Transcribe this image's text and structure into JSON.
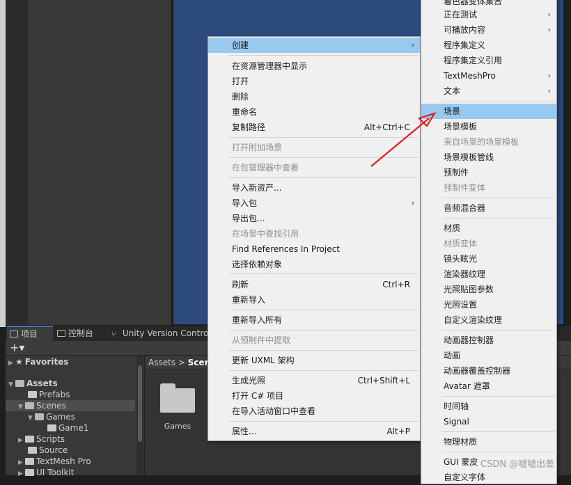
{
  "bottom_tabs": [
    {
      "label": "项目",
      "icon": "folder-icon"
    },
    {
      "label": "控制台",
      "icon": "console-icon"
    },
    {
      "label": "Unity Version Control",
      "icon": "branch-icon"
    }
  ],
  "toolbar": {
    "add_label": "+▾"
  },
  "tree": {
    "favorites": "Favorites",
    "assets": "Assets",
    "items": [
      "Prefabs",
      "Scenes",
      "Games",
      "Game1",
      "Scripts",
      "Source",
      "TextMesh Pro",
      "UI Toolkit"
    ]
  },
  "breadcrumb": {
    "root": "Assets",
    "separator": ">",
    "current": "Scene"
  },
  "content": {
    "folder_label": "Games"
  },
  "menu1": {
    "items": [
      {
        "label": "创建",
        "shortcut": "",
        "submenu": "›"
      },
      {
        "label": "在资源管理器中显示",
        "shortcut": ""
      },
      {
        "label": "打开",
        "shortcut": ""
      },
      {
        "label": "删除",
        "shortcut": ""
      },
      {
        "label": "重命名",
        "shortcut": ""
      },
      {
        "label": "复制路径",
        "shortcut": "Alt+Ctrl+C"
      },
      {
        "label": "打开附加场景",
        "shortcut": ""
      },
      {
        "label": "在包管理器中查看",
        "shortcut": ""
      },
      {
        "label": "导入新资产...",
        "shortcut": ""
      },
      {
        "label": "导入包",
        "shortcut": "",
        "submenu": "›"
      },
      {
        "label": "导出包...",
        "shortcut": ""
      },
      {
        "label": "在场景中查找引用",
        "shortcut": ""
      },
      {
        "label": "Find References In Project",
        "shortcut": ""
      },
      {
        "label": "选择依赖对象",
        "shortcut": ""
      },
      {
        "label": "刷新",
        "shortcut": "Ctrl+R"
      },
      {
        "label": "重新导入",
        "shortcut": ""
      },
      {
        "label": "重新导入所有",
        "shortcut": ""
      },
      {
        "label": "从预制件中提取",
        "shortcut": ""
      },
      {
        "label": "更新 UXML 架构",
        "shortcut": ""
      },
      {
        "label": "生成光照",
        "shortcut": "Ctrl+Shift+L"
      },
      {
        "label": "打开 C# 项目",
        "shortcut": ""
      },
      {
        "label": "在导入活动窗口中查看",
        "shortcut": ""
      },
      {
        "label": "属性...",
        "shortcut": "Alt+P"
      }
    ]
  },
  "menu2": {
    "items": [
      {
        "label": "着色器变体集合",
        "submenu": ""
      },
      {
        "label": "正在测试",
        "submenu": "›"
      },
      {
        "label": "可播放内容",
        "submenu": "›"
      },
      {
        "label": "程序集定义",
        "submenu": ""
      },
      {
        "label": "程序集定义引用",
        "submenu": ""
      },
      {
        "label": "TextMeshPro",
        "submenu": "›"
      },
      {
        "label": "文本",
        "submenu": "›"
      },
      {
        "label": "场景",
        "submenu": ""
      },
      {
        "label": "场景模板",
        "submenu": ""
      },
      {
        "label": "来自场景的场景模板",
        "submenu": ""
      },
      {
        "label": "场景模板管线",
        "submenu": ""
      },
      {
        "label": "预制件",
        "submenu": ""
      },
      {
        "label": "预制件变体",
        "submenu": ""
      },
      {
        "label": "音频混合器",
        "submenu": ""
      },
      {
        "label": "材质",
        "submenu": ""
      },
      {
        "label": "材质变体",
        "submenu": ""
      },
      {
        "label": "镜头眩光",
        "submenu": ""
      },
      {
        "label": "渲染器纹理",
        "submenu": ""
      },
      {
        "label": "光照贴图参数",
        "submenu": ""
      },
      {
        "label": "光照设置",
        "submenu": ""
      },
      {
        "label": "自定义渲染纹理",
        "submenu": ""
      },
      {
        "label": "动画器控制器",
        "submenu": ""
      },
      {
        "label": "动画",
        "submenu": ""
      },
      {
        "label": "动画器覆盖控制器",
        "submenu": ""
      },
      {
        "label": "Avatar 遮罩",
        "submenu": ""
      },
      {
        "label": "时间轴",
        "submenu": ""
      },
      {
        "label": "Signal",
        "submenu": ""
      },
      {
        "label": "物理材质",
        "submenu": ""
      },
      {
        "label": "GUI 蒙皮",
        "submenu": ""
      },
      {
        "label": "自定义字体",
        "submenu": ""
      }
    ]
  },
  "colors": {
    "highlight": "#99c9ef",
    "annotation": "#e02020",
    "scene_bg": "#2d4a7c"
  },
  "watermark": "CSDN @嘘嘘出差"
}
